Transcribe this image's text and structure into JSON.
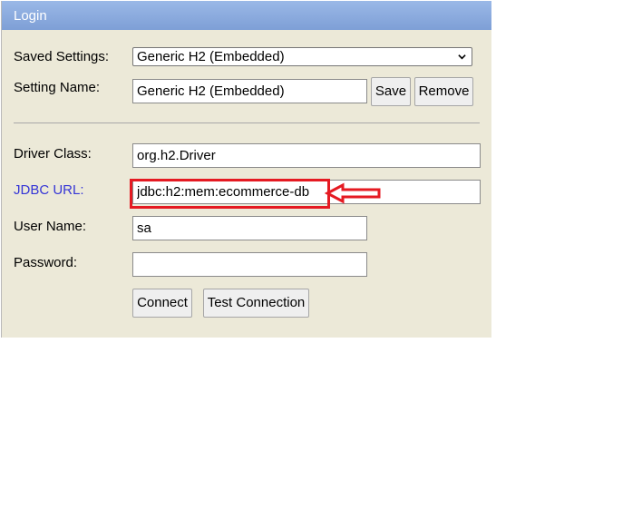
{
  "window": {
    "title": "Login"
  },
  "form": {
    "saved_settings_label": "Saved Settings:",
    "saved_settings_value": "Generic H2 (Embedded)",
    "setting_name_label": "Setting Name:",
    "setting_name_value": "Generic H2 (Embedded)",
    "save_label": "Save",
    "remove_label": "Remove",
    "driver_class_label": "Driver Class:",
    "driver_class_value": "org.h2.Driver",
    "jdbc_url_label": "JDBC URL:",
    "jdbc_url_value": "jdbc:h2:mem:ecommerce-db",
    "user_name_label": "User Name:",
    "user_name_value": "sa",
    "password_label": "Password:",
    "password_value": "",
    "connect_label": "Connect",
    "test_connection_label": "Test Connection"
  },
  "annotation": {
    "highlight_color": "#e51a22",
    "target": "jdbc-url"
  }
}
